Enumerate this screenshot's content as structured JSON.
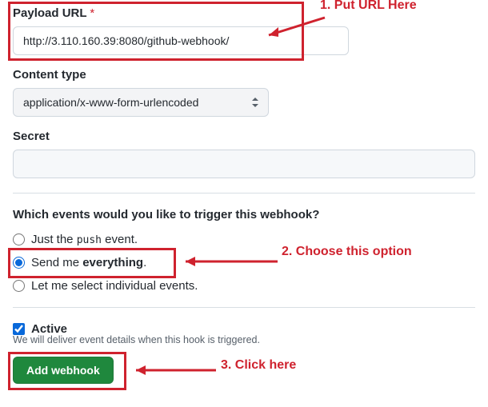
{
  "payload_url": {
    "label": "Payload URL",
    "required_mark": "*",
    "value": "http://3.110.160.39:8080/github-webhook/"
  },
  "content_type": {
    "label": "Content type",
    "selected": "application/x-www-form-urlencoded"
  },
  "secret": {
    "label": "Secret",
    "value": ""
  },
  "events": {
    "heading": "Which events would you like to trigger this webhook?",
    "options": {
      "push_pre": "Just the ",
      "push_mono": "push",
      "push_post": " event.",
      "everything_pre": "Send me ",
      "everything_bold": "everything",
      "everything_post": ".",
      "individual": "Let me select individual events."
    },
    "selected": "everything"
  },
  "active": {
    "label": "Active",
    "checked": true,
    "description": "We will deliver event details when this hook is triggered."
  },
  "submit": {
    "label": "Add webhook"
  },
  "annotations": {
    "a1": "1. Put URL Here",
    "a2": "2. Choose this option",
    "a3": "3. Click here"
  }
}
